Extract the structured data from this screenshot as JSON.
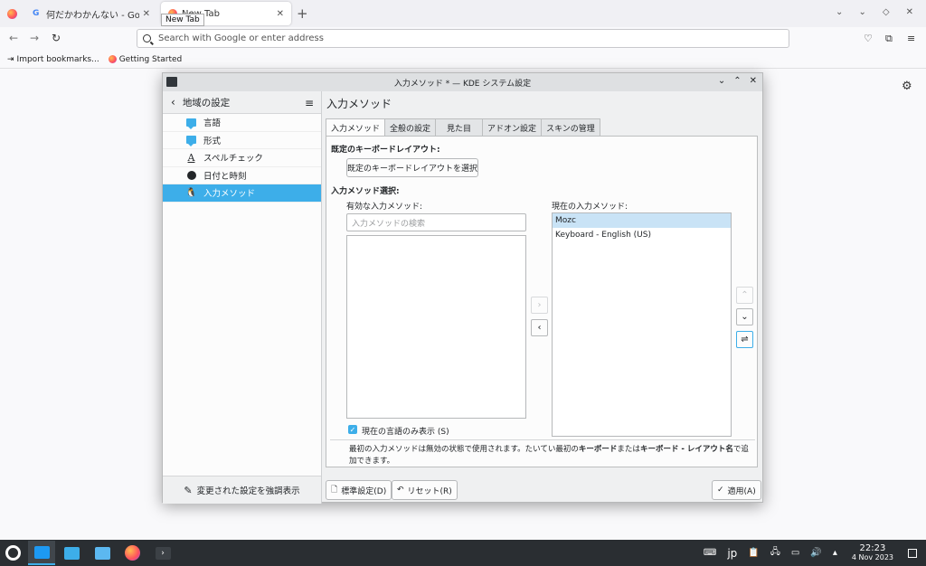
{
  "browser": {
    "tabs": [
      {
        "title": "何だかわかんない - Google"
      },
      {
        "title": "New Tab"
      }
    ],
    "tooltip": "New Tab",
    "url_placeholder": "Search with Google or enter address",
    "bookmarks": [
      "Import bookmarks...",
      "Getting Started"
    ]
  },
  "window": {
    "title": "入力メソッド * — KDE システム設定",
    "sidebar": {
      "header": "地域の設定",
      "items": [
        {
          "label": "言語",
          "icon": "speech-bubble-icon"
        },
        {
          "label": "形式",
          "icon": "speech-bubble-icon"
        },
        {
          "label": "スペルチェック",
          "icon": "spellcheck-icon"
        },
        {
          "label": "日付と時刻",
          "icon": "clock-icon"
        },
        {
          "label": "入力メソッド",
          "icon": "penguin-icon"
        }
      ],
      "footer": "変更された設定を強調表示"
    },
    "page_title": "入力メソッド",
    "tabs": [
      "入力メソッド",
      "全般の設定",
      "見た目",
      "アドオン設定",
      "スキンの管理"
    ],
    "keyboard_layout": {
      "heading": "既定のキーボードレイアウト:",
      "button": "既定のキーボードレイアウトを選択"
    },
    "im_select": {
      "heading": "入力メソッド選択:",
      "available_label": "有効な入力メソッド:",
      "search_placeholder": "入力メソッドの検索",
      "current_label": "現在の入力メソッド:",
      "current_items": [
        "Mozc",
        "Keyboard - English (US)"
      ],
      "only_current_lang": "現在の言語のみ表示 (S)"
    },
    "hint_pre": "最初の入力メソッドは無効の状態で使用されます。たいてい最初の",
    "hint_b1": "キーボード",
    "hint_mid": "または",
    "hint_b2": "キーボード - レイアウト名",
    "hint_post": "で追加できます。",
    "buttons": {
      "defaults": "標準設定(D)",
      "reset": "リセット(R)",
      "apply": "適用(A)"
    }
  },
  "taskbar": {
    "keyboard_layout": "jp",
    "time": "22:23",
    "date": "4 Nov 2023"
  }
}
